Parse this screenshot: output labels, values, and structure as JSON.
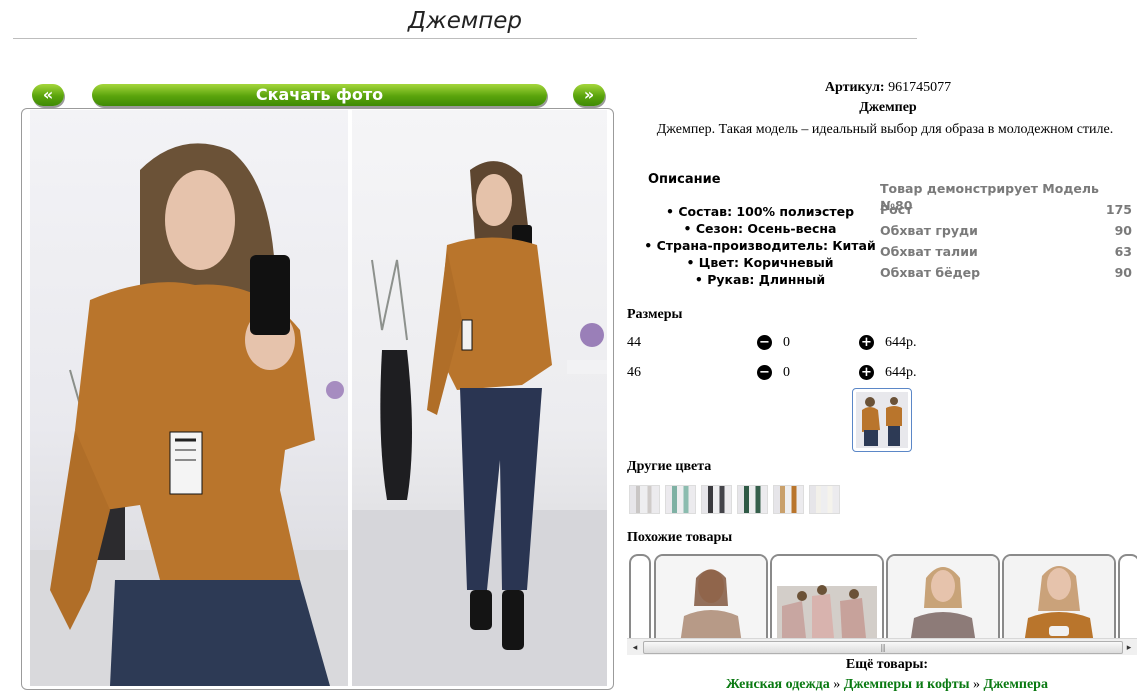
{
  "page": {
    "title": "Джемпер"
  },
  "gallery": {
    "prev": "«",
    "download": "Скачать фото",
    "next": "»"
  },
  "product": {
    "article_label": "Артикул:",
    "article": "961745077",
    "name": "Джемпер",
    "description": "Джемпер. Такая модель – идеальный выбор для образа в молодежном стиле."
  },
  "details": {
    "heading": "Описание",
    "items": [
      "Состав: 100% полиэстер",
      "Сезон: Осень-весна",
      "Страна-производитель: Китай",
      "Цвет: Коричневый",
      "Рукав: Длинный"
    ]
  },
  "model": {
    "heading": "Товар демонстрирует Модель №80",
    "rows": [
      {
        "label": "Рост",
        "value": "175"
      },
      {
        "label": "Обхват груди",
        "value": "90"
      },
      {
        "label": "Обхват талии",
        "value": "63"
      },
      {
        "label": "Обхват бёдер",
        "value": "90"
      }
    ]
  },
  "sizes": {
    "heading": "Размеры",
    "rows": [
      {
        "size": "44",
        "qty": "0",
        "price": "644р."
      },
      {
        "size": "46",
        "qty": "0",
        "price": "644р."
      }
    ],
    "minus_icon": "minus-circle-icon",
    "plus_icon": "plus-circle-icon"
  },
  "other_colors": {
    "heading": "Другие цвета",
    "count": 6
  },
  "similar": {
    "heading": "Похожие товары"
  },
  "more": {
    "heading": "Ещё товары:",
    "links": [
      "Женская одежда",
      "Джемперы и кофты",
      "Джемпера"
    ],
    "separator": "»"
  },
  "colors": {
    "button_green": "#5aa40c",
    "link_green": "#0a7a12",
    "sweater": "#b9752c"
  }
}
